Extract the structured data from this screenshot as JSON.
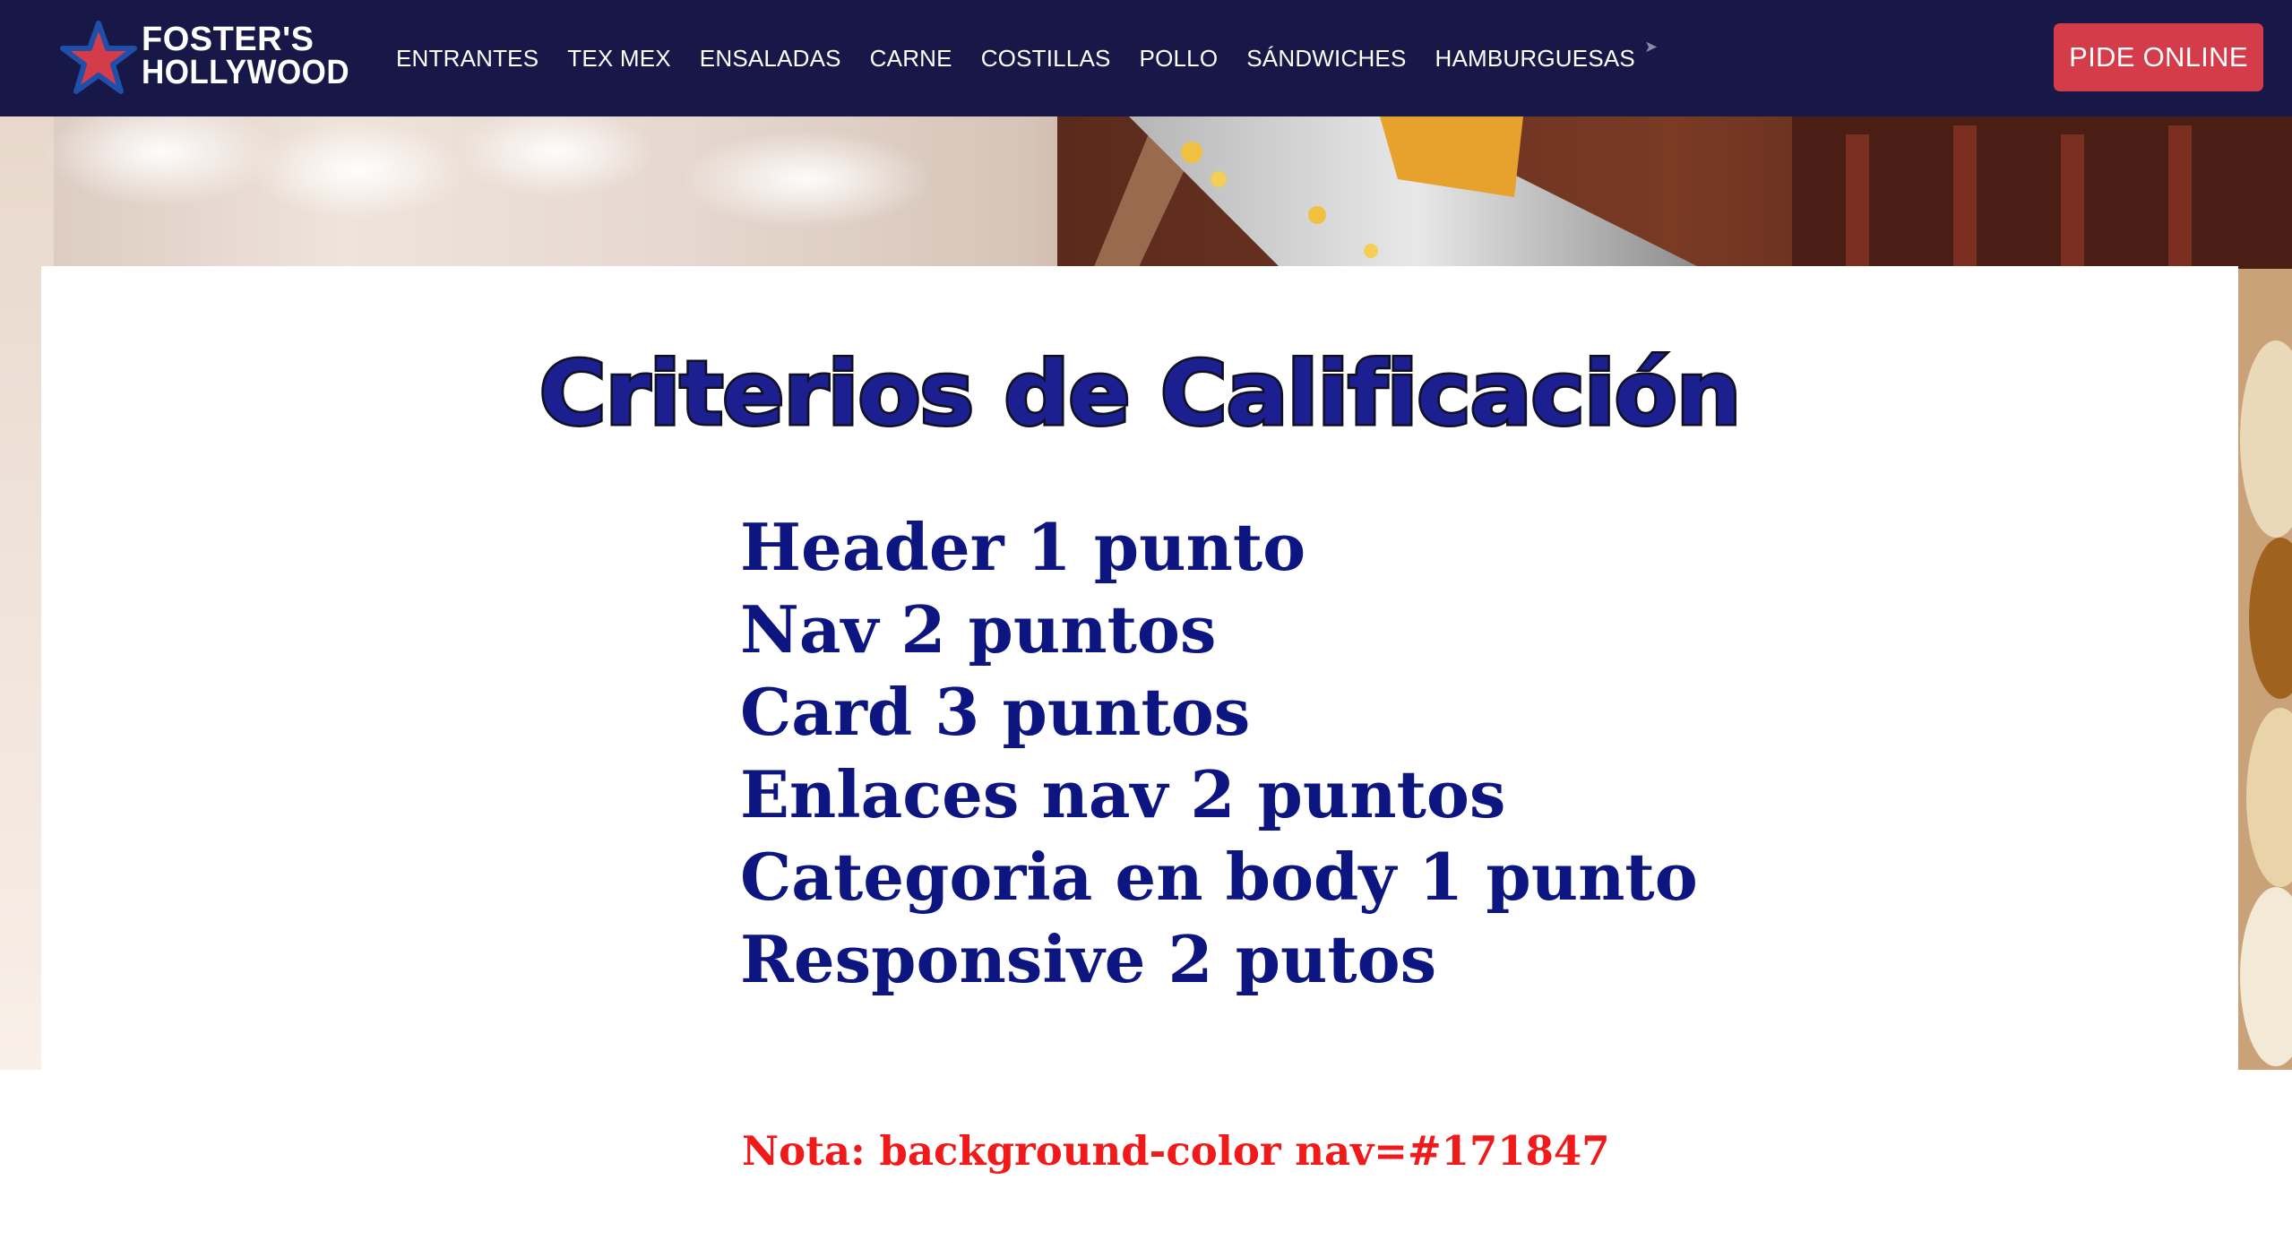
{
  "brand": {
    "logo_line1": "FOSTER'S",
    "logo_line2": "HOLLYWOOD",
    "nav_background": "#171847",
    "accent_red": "#d33c48"
  },
  "nav": {
    "links": [
      {
        "label": "ENTRANTES"
      },
      {
        "label": "TEX MEX"
      },
      {
        "label": "ENSALADAS"
      },
      {
        "label": "CARNE"
      },
      {
        "label": "COSTILLAS"
      },
      {
        "label": "POLLO"
      },
      {
        "label": "SÁNDWICHES"
      },
      {
        "label": "HAMBURGUESAS"
      }
    ],
    "cta_label": "PIDE ONLINE"
  },
  "card": {
    "title": "Criterios de Calificación",
    "criteria": [
      "Header 1 punto",
      "Nav 2 puntos",
      "Card 3 puntos",
      "Enlaces nav 2 puntos",
      "Categoria en body 1 punto",
      "Responsive 2 putos"
    ]
  },
  "note": "Nota: background-color nav=#171847"
}
